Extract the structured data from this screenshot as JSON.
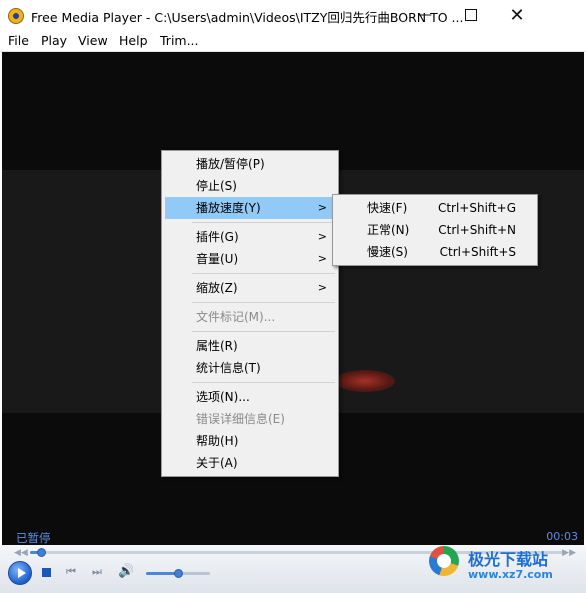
{
  "window": {
    "title": "Free Media Player - C:\\Users\\admin\\Videos\\ITZY回归先行曲BORN TO ...",
    "minimize": "—",
    "close": "✕"
  },
  "menubar": [
    "File",
    "Play",
    "View",
    "Help",
    "Trim..."
  ],
  "player": {
    "status": "已暂停",
    "time": "00:03",
    "seek_rewind_icon": "◀◀",
    "seek_forward_icon": "▶▶",
    "progress_fraction": 0.02,
    "volume_fraction": 0.5
  },
  "context_menu": {
    "items": [
      {
        "label": "播放/暂停(P)"
      },
      {
        "label": "停止(S)"
      },
      {
        "label": "播放速度(Y)",
        "submenu": true
      },
      {
        "label": "插件(G)",
        "submenu": true
      },
      {
        "label": "音量(U)",
        "submenu": true
      },
      {
        "label": "缩放(Z)",
        "submenu": true
      },
      {
        "label": "文件标记(M)...",
        "disabled": true
      },
      {
        "label": "属性(R)"
      },
      {
        "label": "统计信息(T)"
      },
      {
        "label": "选项(N)..."
      },
      {
        "label": "错误详细信息(E)",
        "disabled": true
      },
      {
        "label": "帮助(H)"
      },
      {
        "label": "关于(A)"
      }
    ],
    "submenu_arrow": ">"
  },
  "speed_submenu": {
    "items": [
      {
        "label": "快速(F)",
        "shortcut": "Ctrl+Shift+G"
      },
      {
        "label": "正常(N)",
        "shortcut": "Ctrl+Shift+N"
      },
      {
        "label": "慢速(S)",
        "shortcut": "Ctrl+Shift+S"
      }
    ]
  },
  "watermark": {
    "name": "极光下载站",
    "url": "www.xz7.com"
  },
  "colors": {
    "highlight": "#91c9f7",
    "status_text": "#5d8de0",
    "accent": "#1d5fc8"
  }
}
